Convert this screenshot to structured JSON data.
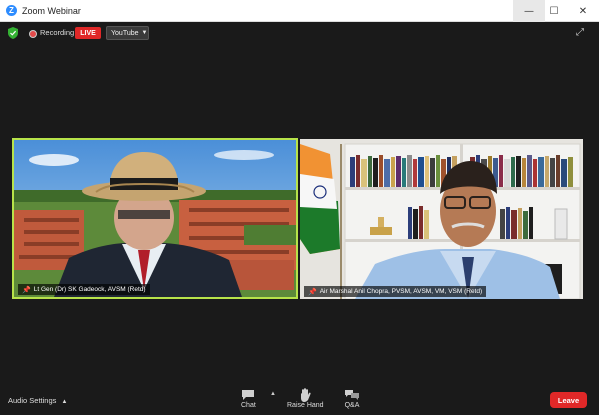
{
  "window": {
    "title": "Zoom Webinar",
    "logo_letter": "Z",
    "minimize": "—",
    "maximize": "☐",
    "close": "✕"
  },
  "status": {
    "recording_label": "Recording",
    "live_badge": "LIVE",
    "stream_target": "YouTube",
    "fullscreen_icon": "⤢",
    "live_color": "#e02828",
    "security_color": "#34b233"
  },
  "videos": [
    {
      "name": "Lt Gen (Dr) SK Gadeock, AVSM (Retd)",
      "active_speaker": true,
      "highlight_color": "#b7e34a"
    },
    {
      "name": "Air Marshal Anil Chopra, PVSM, AVSM, VM, VSM (Retd)",
      "active_speaker": false
    }
  ],
  "toolbar": {
    "audio_settings": "Audio Settings",
    "chat": "Chat",
    "raise_hand": "Raise Hand",
    "qa": "Q&A",
    "leave": "Leave",
    "leave_color": "#e02828"
  }
}
